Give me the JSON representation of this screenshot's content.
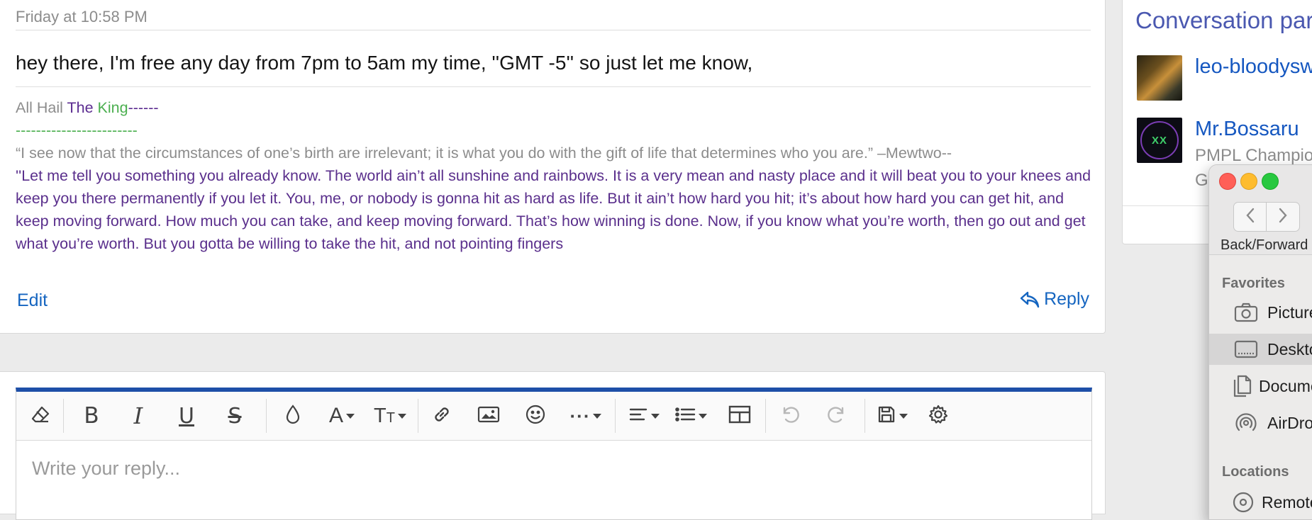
{
  "post": {
    "timestamp": "Friday at 10:58 PM",
    "message": "hey there, I'm free any day from 7pm to 5am my time, ''GMT -5'' so just let me know,",
    "signature": {
      "line1_a": "All Hail ",
      "line1_b": "The ",
      "line1_c": "King",
      "line1_d": "------",
      "line2": "------------------------",
      "quote1": "“I see now that the circumstances of one’s birth are irrelevant; it is what you do with the gift of life that determines who you are.” –Mewtwo--",
      "quote2": "''Let me tell you something you already know. The world ain’t all sunshine and rainbows. It is a very mean and nasty place and it will beat you to your knees and keep you there permanently if you let it. You, me, or nobody is gonna hit as hard as life. But it ain’t how hard you hit; it’s about how hard you can get hit, and keep moving forward. How much you can take, and keep moving forward. That’s how winning is done. Now, if you know what you’re worth, then go out and get what you’re worth. But you gotta be willing to take the hit, and not pointing fingers"
    },
    "edit_label": "Edit",
    "reply_label": "Reply"
  },
  "editor": {
    "placeholder": "Write your reply...",
    "toolbar": [
      "remove-formatting",
      "bold",
      "italic",
      "underline",
      "strikethrough",
      "text-color",
      "font-family",
      "font-size",
      "insert-link",
      "insert-image",
      "smilies",
      "more-options",
      "align",
      "list",
      "insert-table",
      "undo",
      "redo",
      "save-drafts",
      "toggle-bb-code"
    ]
  },
  "sidebar": {
    "title": "Conversation participants",
    "participants": [
      {
        "name": "leo-bloodyswan"
      },
      {
        "name": "Mr.Bossaru",
        "role": "PMPL Champion",
        "extra": "G"
      }
    ]
  },
  "finder": {
    "nav_label": "Back/Forward",
    "favorites_label": "Favorites",
    "favorites": [
      {
        "label": "Pictures",
        "icon": "camera-icon"
      },
      {
        "label": "Desktop",
        "icon": "desktop-icon",
        "selected": true
      },
      {
        "label": "Documents",
        "icon": "document-icon"
      },
      {
        "label": "AirDrop",
        "icon": "airdrop-icon"
      }
    ],
    "locations_label": "Locations",
    "locations": [
      {
        "label": "Remote Disc",
        "icon": "disc-icon"
      }
    ]
  },
  "colors": {
    "accent": "#1e4fa8",
    "link": "#1565c0",
    "sig_purple": "#5c2d91",
    "sig_green": "#4caf50"
  }
}
